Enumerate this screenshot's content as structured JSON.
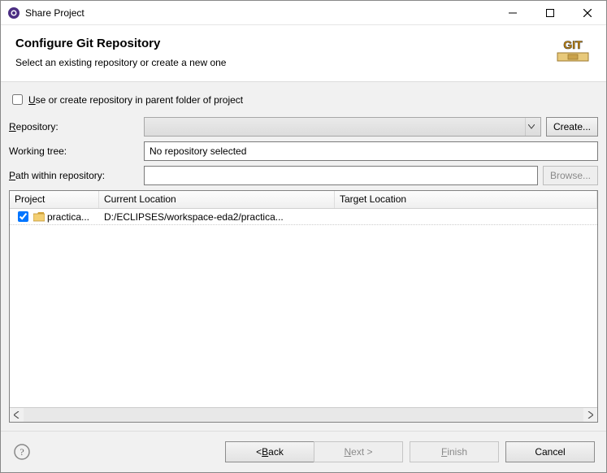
{
  "titlebar": {
    "title": "Share Project"
  },
  "header": {
    "heading": "Configure Git Repository",
    "subtitle": "Select an existing repository or create a new one"
  },
  "content": {
    "checkbox_label_prefix": "",
    "checkbox_u": "U",
    "checkbox_label_rest": "se or create repository in parent folder of project",
    "repo_label_u": "R",
    "repo_label_rest": "epository:",
    "create_label": "Create...",
    "working_tree_label": "Working tree:",
    "working_tree_value": "No repository selected",
    "path_label_u": "P",
    "path_label_rest": "ath within repository:",
    "path_value": "",
    "browse_label": "Browse..."
  },
  "table": {
    "headers": {
      "project": "Project",
      "current": "Current Location",
      "target": "Target Location"
    },
    "rows": [
      {
        "checked": true,
        "name": "practica...",
        "current": "D:/ECLIPSES/workspace-eda2/practica...",
        "target": ""
      }
    ]
  },
  "footer": {
    "back_prefix": "< ",
    "back_u": "B",
    "back_rest": "ack",
    "next_u": "N",
    "next_rest": "ext >",
    "finish_u": "F",
    "finish_rest": "inish",
    "cancel": "Cancel"
  },
  "colors": {
    "content_bg": "#f1f1f1"
  }
}
